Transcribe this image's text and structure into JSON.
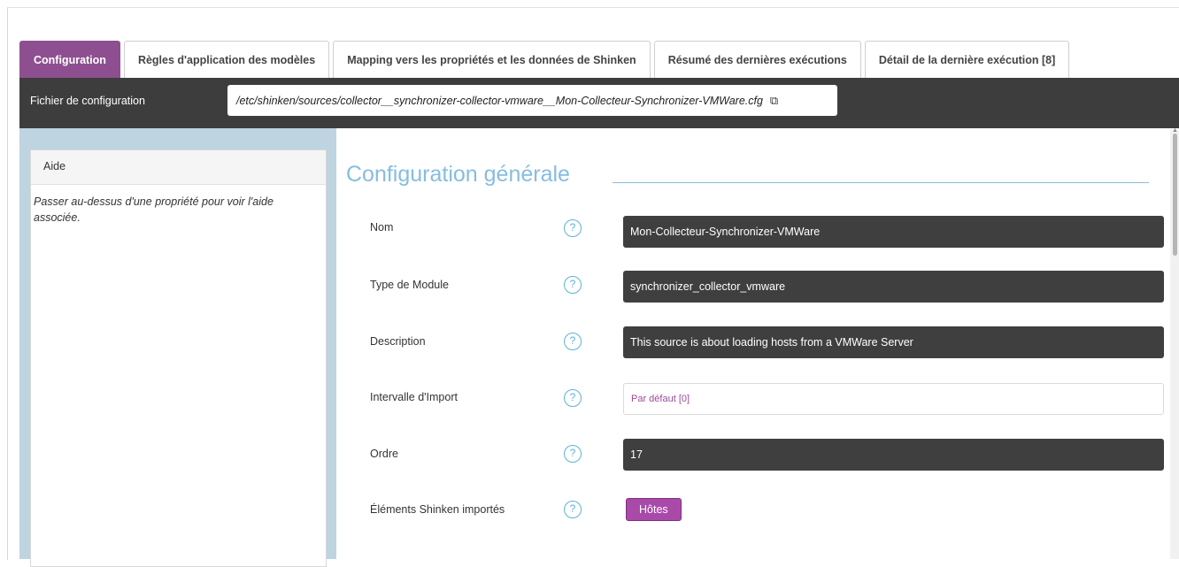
{
  "tabs": [
    {
      "label": "Configuration",
      "active": true
    },
    {
      "label": "Règles d'application des modèles",
      "active": false
    },
    {
      "label": "Mapping vers les propriétés et les données de Shinken",
      "active": false
    },
    {
      "label": "Résumé des dernières exécutions",
      "active": false
    },
    {
      "label": "Détail de la dernière exécution [8]",
      "active": false
    }
  ],
  "config_file": {
    "label": "Fichier de configuration",
    "path": "/etc/shinken/sources/collector__synchronizer-collector-vmware__Mon-Collecteur-Synchronizer-VMWare.cfg",
    "copy_icon": "copy-icon"
  },
  "help": {
    "title": "Aide",
    "text": "Passer au-dessus d'une propriété pour voir l'aide associée."
  },
  "section": {
    "title": "Configuration générale"
  },
  "fields": [
    {
      "label": "Nom",
      "value": "Mon-Collecteur-Synchronizer-VMWare"
    },
    {
      "label": "Type de Module",
      "value": "synchronizer_collector_vmware"
    },
    {
      "label": "Description",
      "value": "This source is about loading hosts from a VMWare Server"
    },
    {
      "label": "Intervalle d'Import",
      "value": "Par défaut [0]"
    },
    {
      "label": "Ordre",
      "value": "17"
    },
    {
      "label": "Éléments Shinken importés",
      "value": "Hôtes"
    }
  ],
  "help_icon_glyph": "?",
  "colors": {
    "active_tab": "#8e4f90",
    "dark_bar": "#3d3d3d",
    "section_title": "#86bde0",
    "badge": "#a94aa8",
    "left_pane": "#bed4e0"
  }
}
